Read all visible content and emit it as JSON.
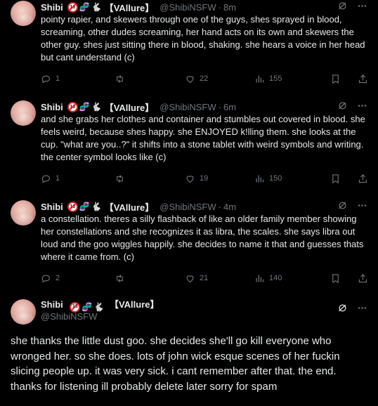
{
  "author": {
    "name": "Shibi",
    "tag": "【VAllure】",
    "handle": "@ShibiNSFW",
    "badge18": "18"
  },
  "tweets": [
    {
      "time": "8m",
      "text": "pointy rapier, and skewers through one of the guys, shes sprayed in blood, screaming, other dudes screaming, her hand acts on its own and skewers the other guy. shes just sitting there in blood, shaking. she hears a voice in her head but cant understand (c)",
      "replies": "1",
      "retweets": "",
      "likes": "22",
      "views": "155"
    },
    {
      "time": "6m",
      "text": "and she grabs her clothes and container and stumbles out covered in blood. she feels weird, because shes happy. she ENJOYED k!lling them. she looks at the cup. \"what are you..?\" it shifts into a stone tablet with weird symbols and writing. the center symbol looks like (c)",
      "replies": "1",
      "retweets": "",
      "likes": "19",
      "views": "150"
    },
    {
      "time": "4m",
      "text": "a constellation. theres a silly flashback of like an older family member showing her constellations and she recognizes it as libra, the scales.  she says libra out loud and the goo wiggles happily. she decides to name it that and guesses thats where it came from. (c)",
      "replies": "2",
      "retweets": "",
      "likes": "21",
      "views": "140"
    }
  ],
  "main_tweet": {
    "text": "she thanks the little dust goo. she decides she'll go kill everyone who wronged her. so she does. lots of  john wick esque scenes of her fuckin slicing people up. it was very sick. i cant remember after that. the end. thanks for listening ill probably delete later sorry for spam"
  },
  "icons": {
    "grok": "grok-icon",
    "more": "more-icon",
    "reply": "reply-icon",
    "retweet": "retweet-icon",
    "like": "like-icon",
    "views": "views-icon",
    "bookmark": "bookmark-icon",
    "share": "share-icon"
  },
  "colors": {
    "background": "#000000",
    "text": "#e7e9ea",
    "muted": "#71767b"
  }
}
